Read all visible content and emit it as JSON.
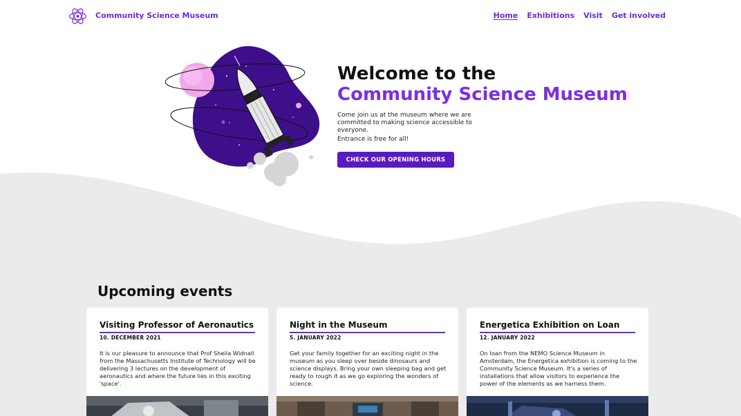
{
  "header": {
    "brand": "Community Science Museum",
    "nav": [
      {
        "label": "Home",
        "active": true
      },
      {
        "label": "Exhibitions",
        "active": false
      },
      {
        "label": "Visit",
        "active": false
      },
      {
        "label": "Get involved",
        "active": false
      }
    ]
  },
  "hero": {
    "title_line1": "Welcome to the",
    "title_line2": "Community Science Museum",
    "paragraph1": "Come join us at the museum where we are committed to making science accessible to everyone.",
    "paragraph2": "Entrance is free for all!",
    "cta_label": "CHECK OUR OPENING HOURS"
  },
  "events": {
    "title": "Upcoming events",
    "items": [
      {
        "title": "Visiting Professor of Aeronautics",
        "date": "10. DECEMBER 2021",
        "description": "It is our pleasure to announce that Prof Sheila Widnall from the Massachusetts Institute of Technology will be delivering 3 lectures on the development of aeronautics and where the future lies in this exciting 'space'."
      },
      {
        "title": "Night in the Museum",
        "date": "5. JANUARY 2022",
        "description": "Get your family together for an exciting night in the museum as you sleep over beside dinosaurs and science displays. Bring your own sleeping bag and get ready to rough it as we go exploring the wonders of science."
      },
      {
        "title": "Energetica Exhibition on Loan",
        "date": "12. JANUARY 2022",
        "description": "On loan from the NEMO Science Museum in Amsterdam, the Energetica exhibition is coming to the Community Science Museum. It's a series of installations that allow visitors to experience the power of the elements as we harness them."
      }
    ]
  },
  "colors": {
    "accent": "#6c2bd9",
    "accent_light": "#7b2fe0",
    "button": "#5b19c4",
    "section_bg": "#ebebeb"
  }
}
